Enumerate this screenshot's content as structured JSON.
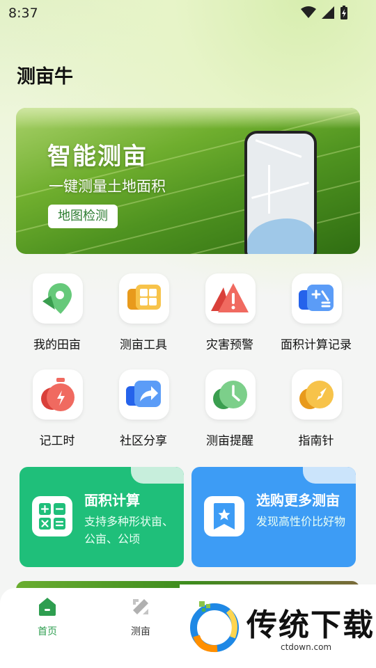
{
  "status_bar": {
    "time": "8:37"
  },
  "app": {
    "title": "测亩牛"
  },
  "banner": {
    "headline": "智能测亩",
    "subline": "一键测量土地面积",
    "button_label": "地图检测"
  },
  "grid": [
    {
      "label": "我的田亩",
      "icon": "map-pin-icon",
      "color": "#45b85c"
    },
    {
      "label": "测亩工具",
      "icon": "grid-tools-icon",
      "color": "#f2a928"
    },
    {
      "label": "灾害预警",
      "icon": "warning-triangle-icon",
      "color": "#ef5350"
    },
    {
      "label": "面积计算记录",
      "icon": "calculator-record-icon",
      "color": "#3b82f6"
    },
    {
      "label": "记工时",
      "icon": "stopwatch-icon",
      "color": "#ef5350"
    },
    {
      "label": "社区分享",
      "icon": "share-arrow-icon",
      "color": "#3b82f6"
    },
    {
      "label": "测亩提醒",
      "icon": "clock-icon",
      "color": "#45b85c"
    },
    {
      "label": "指南针",
      "icon": "compass-icon",
      "color": "#f2a928"
    }
  ],
  "cards": {
    "area": {
      "title": "面积计算",
      "desc": "支持多种形状亩、公亩、公顷"
    },
    "shop": {
      "title": "选购更多测亩",
      "desc": "发现高性价比好物"
    }
  },
  "tabbar": {
    "home_label": "首页",
    "measure_label": "测亩"
  },
  "watermark": {
    "text": "传统下载",
    "url": "ctdown.com"
  },
  "colors": {
    "accent_green": "#1fbf7a",
    "accent_blue": "#3d9cf5",
    "tab_active": "#2e9e50"
  }
}
